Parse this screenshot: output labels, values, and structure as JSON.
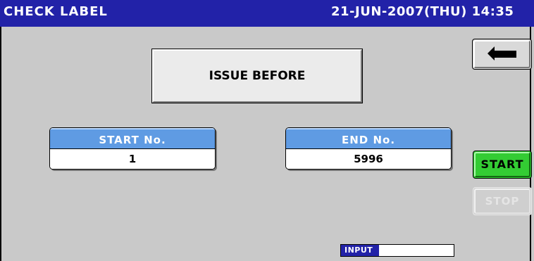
{
  "title_bar": {
    "title": "CHECK LABEL",
    "datetime": "21-JUN-2007(THU) 14:35"
  },
  "status_box": {
    "text": "ISSUE BEFORE"
  },
  "start_number": {
    "label": "START No.",
    "value": "1"
  },
  "end_number": {
    "label": "END No.",
    "value": "5996"
  },
  "buttons": {
    "back_icon": "return-arrow-icon",
    "start_label": "START",
    "stop_label": "STOP"
  },
  "input_mode": {
    "label": "INPUT"
  },
  "colors": {
    "title_bar": "#2222a8",
    "field_header": "#5f9be3",
    "start_button": "#33cc33",
    "background": "#c9c9c9"
  }
}
